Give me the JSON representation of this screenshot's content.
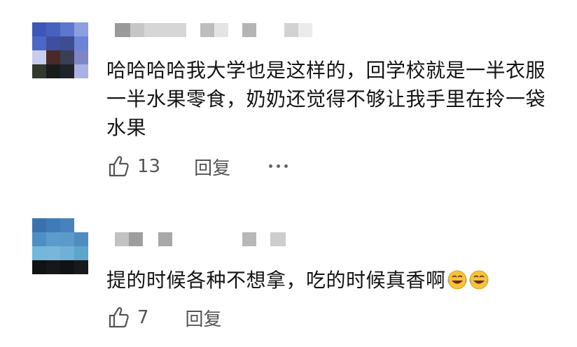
{
  "comments": [
    {
      "text": "哈哈哈哈我大学也是这样的，回学校就是一半衣服一半水果零食，奶奶还觉得不够让我手里在拎一袋水果",
      "likes": "13",
      "reply_label": "回复",
      "more_icon": "more-horizontal-icon",
      "like_icon": "thumbs-up-icon"
    },
    {
      "text": "提的时候各种不想拿，吃的时候真香啊",
      "emoji": "laughing-crying-emoji",
      "likes": "7",
      "reply_label": "回复",
      "like_icon": "thumbs-up-icon"
    }
  ]
}
